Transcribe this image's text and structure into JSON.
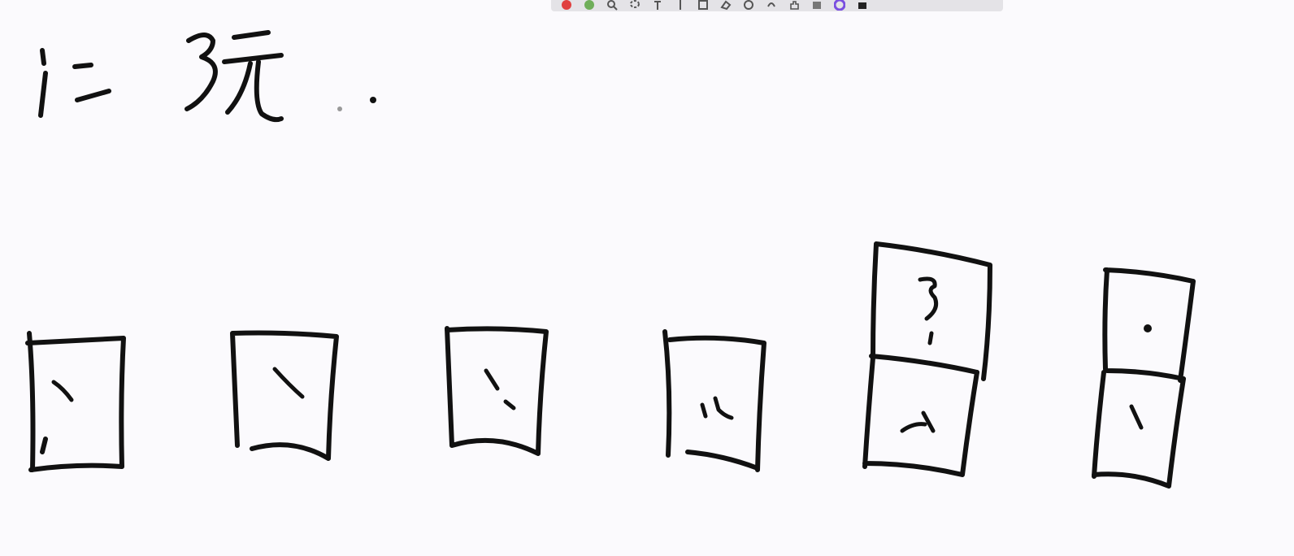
{
  "toolbar": {
    "icons": [
      {
        "name": "pen-red-icon",
        "color": "#e04040"
      },
      {
        "name": "pen-green-icon",
        "color": "#6fae5a"
      },
      {
        "name": "search-icon",
        "color": "#555555"
      },
      {
        "name": "lasso-icon",
        "color": "#555555"
      },
      {
        "name": "text-icon",
        "color": "#555555"
      },
      {
        "name": "insert-space-icon",
        "color": "#555555"
      },
      {
        "name": "shape-icon",
        "color": "#555555"
      },
      {
        "name": "eraser-icon",
        "color": "#555555"
      },
      {
        "name": "undo-icon",
        "color": "#555555"
      },
      {
        "name": "redo-icon",
        "color": "#555555"
      },
      {
        "name": "hand-icon",
        "color": "#555555"
      },
      {
        "name": "image-icon",
        "color": "#555555"
      },
      {
        "name": "color-wheel-icon",
        "color": "#7a4fe0"
      },
      {
        "name": "ink-black-icon",
        "color": "#222222"
      }
    ]
  },
  "board": {
    "background": "#fbfafd",
    "ink_color": "#111111"
  }
}
